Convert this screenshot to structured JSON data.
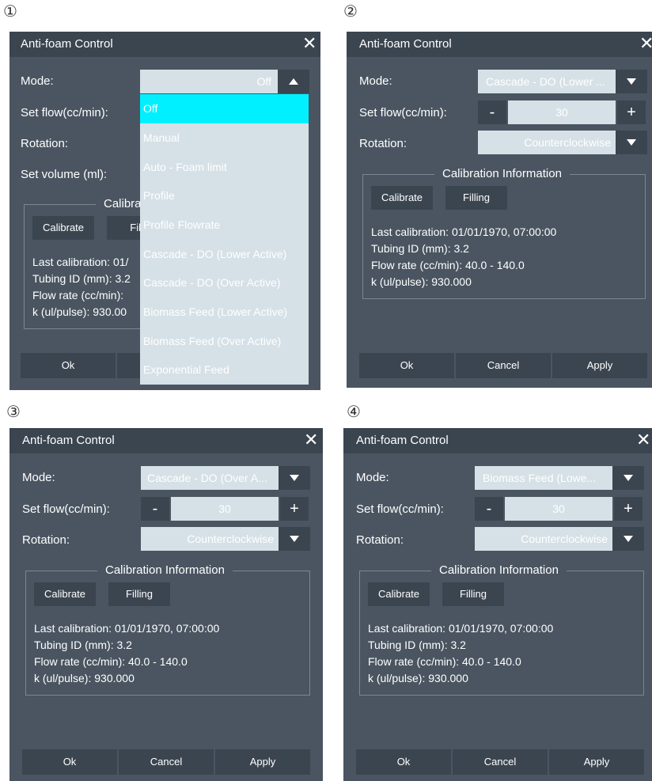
{
  "panels": [
    {
      "marker": "①",
      "title": "Anti-foam Control",
      "close": "✕",
      "mode_label": "Mode:",
      "mode_value": "Off",
      "setflow_label": "Set flow(cc/min):",
      "rotation_label": "Rotation:",
      "volume_label": "Set volume (ml):",
      "cal_title_partial": "Calibra",
      "calibrate": "Calibrate",
      "filling_partial": "Filli",
      "info": [
        "Last calibration: 01/",
        "Tubing ID (mm): 3.2",
        "Flow rate (cc/min):",
        "k (ul/pulse): 930.00"
      ],
      "ok": "Ok",
      "dropdown_items": [
        "Off",
        "Manual",
        "Auto - Foam limit",
        "Profile",
        "Profile Flowrate",
        "Cascade - DO (Lower Active)",
        "Cascade - DO (Over Active)",
        "Biomass Feed (Lower Active)",
        "Biomass Feed (Over Active)",
        "Exponential Feed"
      ],
      "selected_index": 0
    },
    {
      "marker": "②",
      "title": "Anti-foam Control",
      "close": "✕",
      "mode_label": "Mode:",
      "mode_value": "Cascade - DO (Lower ...",
      "setflow_label": "Set flow(cc/min):",
      "minus": "-",
      "plus": "+",
      "flow_value": "30",
      "rotation_label": "Rotation:",
      "rotation_value": "Counterclockwise",
      "cal_title": "Calibration Information",
      "calibrate": "Calibrate",
      "filling": "Filling",
      "info": [
        "Last calibration: 01/01/1970, 07:00:00",
        "Tubing ID (mm): 3.2",
        "Flow rate (cc/min): 40.0 - 140.0",
        "k (ul/pulse): 930.000"
      ],
      "ok": "Ok",
      "cancel": "Cancel",
      "apply": "Apply"
    },
    {
      "marker": "③",
      "title": "Anti-foam Control",
      "close": "✕",
      "mode_label": "Mode:",
      "mode_value": "Cascade - DO (Over A...",
      "setflow_label": "Set flow(cc/min):",
      "minus": "-",
      "plus": "+",
      "flow_value": "30",
      "rotation_label": "Rotation:",
      "rotation_value": "Counterclockwise",
      "cal_title": "Calibration Information",
      "calibrate": "Calibrate",
      "filling": "Filling",
      "info": [
        "Last calibration: 01/01/1970, 07:00:00",
        "Tubing ID (mm): 3.2",
        "Flow rate (cc/min): 40.0 - 140.0",
        "k (ul/pulse): 930.000"
      ],
      "ok": "Ok",
      "cancel": "Cancel",
      "apply": "Apply"
    },
    {
      "marker": "④",
      "title": "Anti-foam Control",
      "close": "✕",
      "mode_label": "Mode:",
      "mode_value": "Biomass Feed (Lowe...",
      "setflow_label": "Set flow(cc/min):",
      "minus": "-",
      "plus": "+",
      "flow_value": "30",
      "rotation_label": "Rotation:",
      "rotation_value": "Counterclockwise",
      "cal_title": "Calibration Information",
      "calibrate": "Calibrate",
      "filling": "Filling",
      "info": [
        "Last calibration: 01/01/1970, 07:00:00",
        "Tubing ID (mm): 3.2",
        "Flow rate (cc/min): 40.0 - 140.0",
        "k (ul/pulse): 930.000"
      ],
      "ok": "Ok",
      "cancel": "Cancel",
      "apply": "Apply"
    }
  ],
  "colors": {
    "dialog_bg": "#4a5561",
    "titlebar_bg": "#3b4550",
    "field_bg": "#d6e1e7",
    "selected_item": "#00f0ff",
    "button_bg": "#3b4550"
  }
}
